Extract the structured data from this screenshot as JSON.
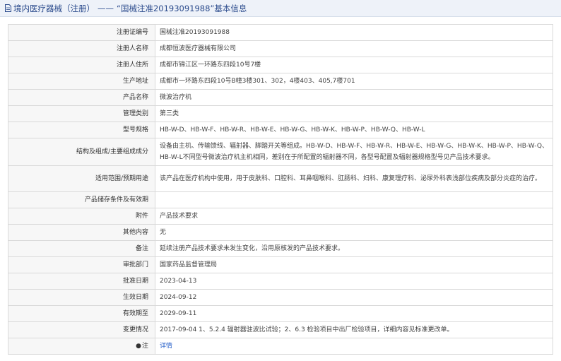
{
  "header": {
    "section": "境内医疗器械（注册）",
    "separator": "——",
    "record_title": "“国械注准20193091988”基本信息"
  },
  "rows": [
    {
      "label": "注册证编号",
      "value": "国械注准20193091988"
    },
    {
      "label": "注册人名称",
      "value": "成都恒波医疗器械有限公司"
    },
    {
      "label": "注册人住所",
      "value": "成都市锦江区一环路东四段10号7楼"
    },
    {
      "label": "生产地址",
      "value": "成都市一环路东四段10号B幢3楼301、302，4楼403、405,7楼701"
    },
    {
      "label": "产品名称",
      "value": "微波治疗机"
    },
    {
      "label": "管理类别",
      "value": "第三类"
    },
    {
      "label": "型号规格",
      "value": "HB-W-D、HB-W-F、HB-W-R、HB-W-E、HB-W-G、HB-W-K、HB-W-P、HB-W-Q、HB-W-L"
    },
    {
      "label": "结构及组成/主要组成成分",
      "value": "设备由主机、传输馈线、辐射器、脚踏开关等组成。HB-W-D、HB-W-F、HB-W-R、HB-W-E、HB-W-G、HB-W-K、HB-W-P、HB-W-Q、HB-W-L不同型号微波治疗机主机相同，差别在于所配置的辐射器不同，各型号配置及辐射器规格型号见产品技术要求。"
    },
    {
      "label": "适用范围/预期用途",
      "value": "该产品在医疗机构中使用，用于皮肤科、口腔科、耳鼻咽喉科、肛肠科、妇科、康复理疗科、泌尿外科表浅部位疾病及部分炎症的治疗。"
    },
    {
      "label": "产品储存条件及有效期",
      "value": ""
    },
    {
      "label": "附件",
      "value": "产品技术要求"
    },
    {
      "label": "其他内容",
      "value": "无"
    },
    {
      "label": "备注",
      "value": "延续注册产品技术要求未发生变化，沿用原核发的产品技术要求。"
    },
    {
      "label": "审批部门",
      "value": "国家药品监督管理局"
    },
    {
      "label": "批准日期",
      "value": "2023-04-13"
    },
    {
      "label": "生效日期",
      "value": "2024-09-12"
    },
    {
      "label": "有效期至",
      "value": "2029-09-11"
    },
    {
      "label": "变更情况",
      "value": "2017-09-04 1、5.2.4 辐射器驻波比试验；2、6.3 检验项目中出厂检验项目，详细内容见标准更改单。"
    }
  ],
  "note_row": {
    "icon_glyph": "●",
    "label": "注",
    "link_text": "详情",
    "icon": "bullet-icon"
  },
  "colors": {
    "link": "#2a62c9",
    "label_bg": "#f7f7f7",
    "header_bg": "#eef2f9"
  }
}
